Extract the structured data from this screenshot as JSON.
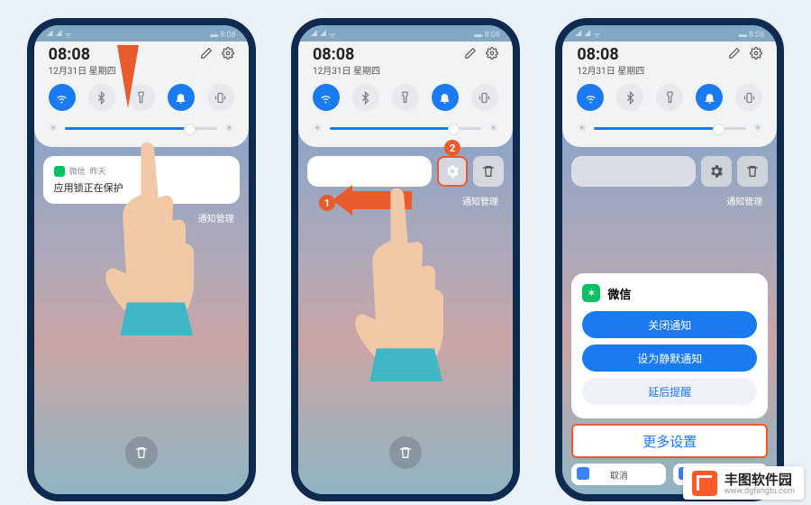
{
  "status": {
    "time": "8:08"
  },
  "shade": {
    "clock": "08:08",
    "date": "12月31日 星期四",
    "mgmt": "通知管理"
  },
  "notif": {
    "app": "微信",
    "when": "昨天",
    "title": "应用锁正在保护"
  },
  "step2": {
    "badge1": "1",
    "badge2": "2"
  },
  "sheet": {
    "app": "微信",
    "close": "关闭通知",
    "silent": "设为静默通知",
    "delay": "延后提醒",
    "more": "更多设置",
    "cancel": "取消"
  },
  "watermark": {
    "cn": "丰图软件园",
    "en": "www.dgfengtu.com"
  }
}
